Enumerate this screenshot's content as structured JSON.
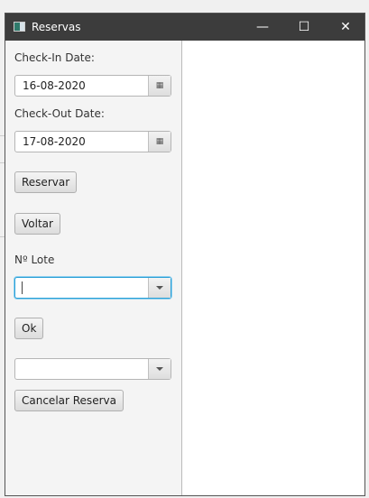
{
  "window": {
    "title": "Reservas",
    "minimize": "—",
    "maximize": "☐",
    "close": "✕"
  },
  "form": {
    "checkin_label": "Check-In Date:",
    "checkin_value": "16-08-2020",
    "checkout_label": "Check-Out Date:",
    "checkout_value": "17-08-2020",
    "reservar": "Reservar",
    "voltar": "Voltar",
    "lote_label": "Nº Lote",
    "lote_value": "",
    "ok": "Ok",
    "reserva_combo_value": "",
    "cancelar": "Cancelar Reserva",
    "calendar_glyph": "▦"
  }
}
